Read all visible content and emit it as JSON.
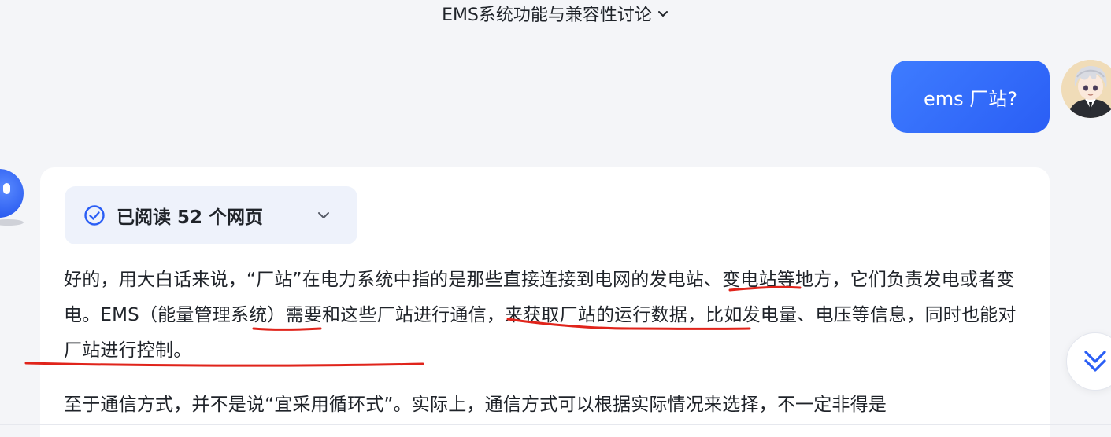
{
  "header": {
    "title": "EMS系统功能与兼容性讨论"
  },
  "user_message": {
    "text": "ems 厂站?"
  },
  "assistant": {
    "read_status": "已阅读 52 个网页",
    "paragraphs": [
      "好的，用大白话来说，“厂站”在电力系统中指的是那些直接连接到电网的发电站、变电站等地方，它们负责发电或者变电。EMS（能量管理系统）需要和这些厂站进行通信，来获取厂站的运行数据，比如发电量、电压等信息，同时也能对厂站进行控制。",
      "至于通信方式，并不是说“宜采用循环式”。实际上，通信方式可以根据实际情况来选择，不一定非得是"
    ]
  },
  "icons": {
    "title_dropdown": "chevron-down-icon",
    "read_check": "check-circle-icon",
    "read_expand": "chevron-down-icon",
    "scroll_down": "double-chevron-down-icon",
    "bot": "bot-avatar-icon"
  },
  "colors": {
    "accent": "#2a5ef5",
    "bubble_start": "#3e7cff",
    "annotation": "#e0241b",
    "text": "#1f2329"
  }
}
